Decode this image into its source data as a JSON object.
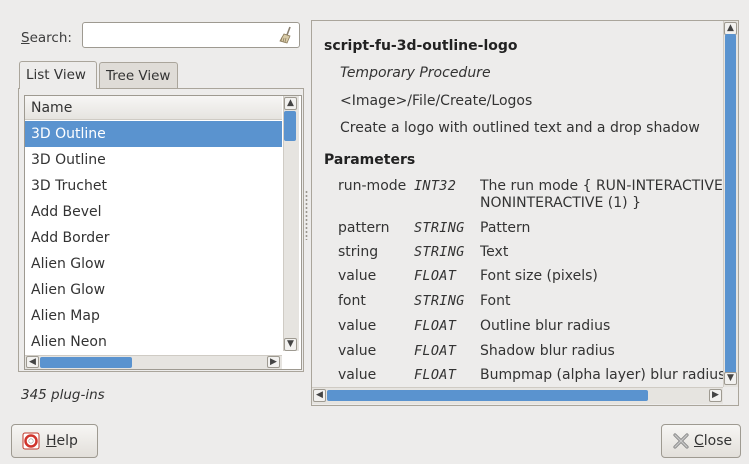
{
  "search": {
    "label_mnemonic": "S",
    "label_rest": "earch:",
    "value": ""
  },
  "tabs": [
    {
      "label": "List View",
      "active": true
    },
    {
      "label": "Tree View",
      "active": false
    }
  ],
  "list": {
    "column_header": "Name",
    "items": [
      {
        "label": "3D Outline",
        "selected": true
      },
      {
        "label": "3D Outline",
        "selected": false
      },
      {
        "label": "3D Truchet",
        "selected": false
      },
      {
        "label": "Add Bevel",
        "selected": false
      },
      {
        "label": "Add Border",
        "selected": false
      },
      {
        "label": "Alien Glow",
        "selected": false
      },
      {
        "label": "Alien Glow",
        "selected": false
      },
      {
        "label": "Alien Map",
        "selected": false
      },
      {
        "label": "Alien Neon",
        "selected": false
      }
    ],
    "count_text": "345 plug-ins"
  },
  "details": {
    "name": "script-fu-3d-outline-logo",
    "type": "Temporary Procedure",
    "menu_path": "<Image>/File/Create/Logos",
    "description": "Create a logo with outlined text and a drop shadow",
    "parameters_heading": "Parameters",
    "parameters": [
      {
        "name": "run-mode",
        "type": "INT32",
        "desc": "The run mode { RUN-INTERACTIVE (0), RUN-",
        "desc2": "NONINTERACTIVE (1) }"
      },
      {
        "name": "pattern",
        "type": "STRING",
        "desc": "Pattern"
      },
      {
        "name": "string",
        "type": "STRING",
        "desc": "Text"
      },
      {
        "name": "value",
        "type": "FLOAT",
        "desc": "Font size (pixels)"
      },
      {
        "name": "font",
        "type": "STRING",
        "desc": "Font"
      },
      {
        "name": "value",
        "type": "FLOAT",
        "desc": "Outline blur radius"
      },
      {
        "name": "value",
        "type": "FLOAT",
        "desc": "Shadow blur radius"
      },
      {
        "name": "value",
        "type": "FLOAT",
        "desc": "Bumpmap (alpha layer) blur radius"
      }
    ]
  },
  "buttons": {
    "help": {
      "mnemonic": "H",
      "rest": "elp"
    },
    "close": {
      "mnemonic": "C",
      "rest": "lose"
    }
  },
  "colors": {
    "selection": "#5a93cf",
    "background": "#edeceb"
  }
}
